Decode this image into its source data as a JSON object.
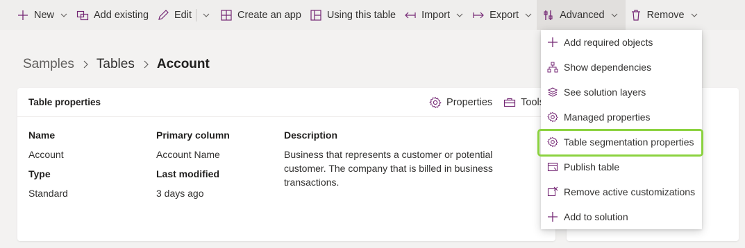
{
  "toolbar": {
    "new": "New",
    "add_existing": "Add existing",
    "edit": "Edit",
    "create_app": "Create an app",
    "using_table": "Using this table",
    "import": "Import",
    "export": "Export",
    "advanced": "Advanced",
    "remove": "Remove"
  },
  "breadcrumb": {
    "root": "Samples",
    "middle": "Tables",
    "current": "Account"
  },
  "card": {
    "title": "Table properties",
    "properties_label": "Properties",
    "tools_label": "Tools"
  },
  "props": {
    "name_label": "Name",
    "name_value": "Account",
    "type_label": "Type",
    "type_value": "Standard",
    "primary_label": "Primary column",
    "primary_value": "Account Name",
    "modified_label": "Last modified",
    "modified_value": "3 days ago",
    "description_label": "Description",
    "description_value": "Business that represents a customer or potential customer. The company that is billed in business transactions."
  },
  "menu": {
    "items": [
      {
        "label": "Add required objects",
        "icon": "plus-icon"
      },
      {
        "label": "Show dependencies",
        "icon": "hierarchy-icon"
      },
      {
        "label": "See solution layers",
        "icon": "layers-icon"
      },
      {
        "label": "Managed properties",
        "icon": "gear-icon"
      },
      {
        "label": "Table segmentation properties",
        "icon": "gear-icon"
      },
      {
        "label": "Publish table",
        "icon": "publish-icon"
      },
      {
        "label": "Remove active customizations",
        "icon": "remove-customizations-icon"
      },
      {
        "label": "Add to solution",
        "icon": "plus-icon"
      }
    ],
    "highlighted_index": 4
  },
  "colors": {
    "accent": "#742774",
    "highlight": "#8bd23f"
  }
}
